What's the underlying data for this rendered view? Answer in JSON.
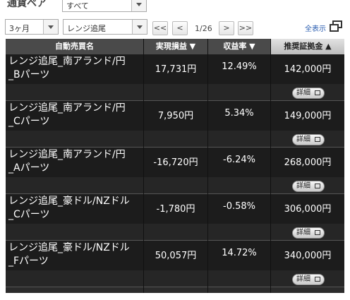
{
  "filter": {
    "currency_pair_label": "通貨ペア",
    "currency_pair_value": "すべて",
    "period_value": "3ヶ月",
    "type_value": "レンジ追尾"
  },
  "pager": {
    "first": "<<",
    "prev": "<",
    "page": "1/26",
    "next": ">",
    "last": ">>",
    "show_all": "全表示"
  },
  "table": {
    "headers": [
      "自動売買名",
      "実現損益 ▼",
      "収益率 ▼",
      "推奨証拠金 ▲"
    ],
    "detail_label": "詳細",
    "rows": [
      {
        "name": "レンジ追尾_南アランド/円\n_Bパーツ",
        "profit": "17,731円",
        "rate": "12.49%",
        "margin": "142,000円"
      },
      {
        "name": "レンジ追尾_南アランド/円\n_Cパーツ",
        "profit": "7,950円",
        "rate": "5.34%",
        "margin": "149,000円"
      },
      {
        "name": "レンジ追尾_南アランド/円\n_Aパーツ",
        "profit": "-16,720円",
        "rate": "-6.24%",
        "margin": "268,000円"
      },
      {
        "name": "レンジ追尾_豪ドル/NZドル\n_Cパーツ",
        "profit": "-1,780円",
        "rate": "-0.58%",
        "margin": "306,000円"
      },
      {
        "name": "レンジ追尾_豪ドル/NZドル\n_Fパーツ",
        "profit": "50,057円",
        "rate": "14.72%",
        "margin": "340,000円"
      }
    ]
  }
}
